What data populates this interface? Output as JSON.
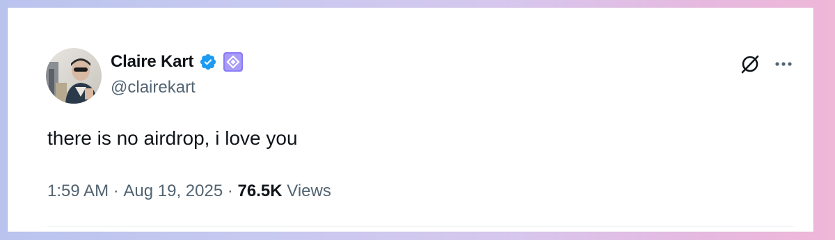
{
  "author": {
    "display_name": "Claire Kart",
    "handle": "@clairekart",
    "verified_icon": "verified-badge-icon",
    "affiliate_icon": "diamond-badge-icon"
  },
  "tweet": {
    "text": "there is no airdrop, i love you"
  },
  "meta": {
    "time": "1:59 AM",
    "separator": "·",
    "date": "Aug 19, 2025",
    "views_count": "76.5K",
    "views_label": "Views"
  },
  "actions": {
    "grok_icon": "grok-icon",
    "more_icon": "more-options-icon"
  },
  "colors": {
    "verified_blue": "#1d9bf0",
    "affiliate_purple": "#8b7cf6",
    "text_primary": "#0f1419",
    "text_secondary": "#536471"
  }
}
